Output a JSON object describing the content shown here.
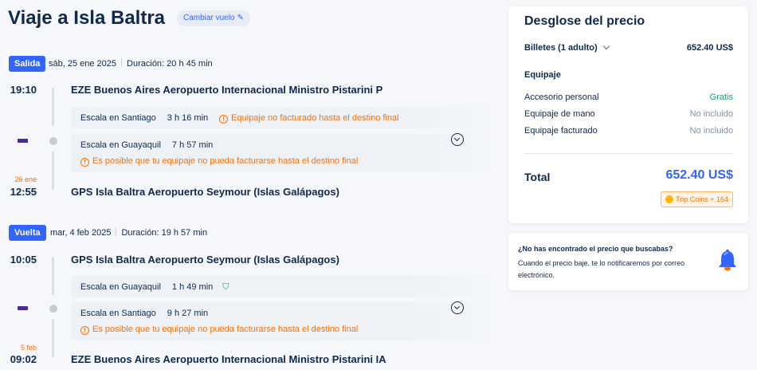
{
  "trip": {
    "title": "Viaje a Isla Baltra",
    "change_label": "Cambiar vuelo",
    "change_icon": "pencil-icon"
  },
  "outbound": {
    "badge": "Salida",
    "date": "sáb, 25 ene 2025",
    "duration": "Duración: 20 h 45 min",
    "dep_time": "19:10",
    "dep_airport": "EZE Buenos Aires Aeropuerto Internacional Ministro Pistarini P",
    "stops": [
      {
        "label": "Escala en Santiago",
        "duration": "3 h 16 min",
        "note": "Equipaje no facturado hasta el destino final"
      },
      {
        "label": "Escala en Guayaquil",
        "duration": "7 h 57 min",
        "note": "Es posible que tu equipaje no pueda facturarse hasta el destino final"
      }
    ],
    "arr_day": "26 ene",
    "arr_time": "12:55",
    "arr_airport": "GPS Isla Baltra Aeropuerto Seymour (Islas Galápagos)"
  },
  "return": {
    "badge": "Vuelta",
    "date": "mar, 4 feb 2025",
    "duration": "Duración: 19 h 57 min",
    "dep_time": "10:05",
    "dep_airport": "GPS Isla Baltra Aeropuerto Seymour (Islas Galápagos)",
    "stops": [
      {
        "label": "Escala en Guayaquil",
        "duration": "1 h 49 min",
        "icon": "shield-icon"
      },
      {
        "label": "Escala en Santiago",
        "duration": "9 h 27 min",
        "note": "Es posible que tu equipaje no pueda facturarse hasta el destino final"
      }
    ],
    "arr_day": "5 feb",
    "arr_time": "09:02",
    "arr_airport": "EZE Buenos Aires Aeropuerto Internacional Ministro Pistarini IA"
  },
  "price": {
    "title": "Desglose del precio",
    "tickets_label": "Billetes (1 adulto)",
    "tickets_value": "652.40 US$",
    "baggage_heading": "Equipaje",
    "items": [
      {
        "label": "Accesorio personal",
        "value": "Gratis"
      },
      {
        "label": "Equipaje de mano",
        "value": "No incluido"
      },
      {
        "label": "Equipaje facturado",
        "value": "No incluido"
      }
    ],
    "total_label": "Total",
    "total_value": "652.40 US$",
    "coins": "Trip Coins + 164"
  },
  "alert": {
    "title": "¿No has encontrado el precio que buscabas?",
    "text": "Cuando el precio baje, te lo notificaremos por correo electrónico."
  },
  "colors": {
    "accent": "#3264ff",
    "warning": "#ff6f00",
    "success": "#12a67a",
    "text": "#0f294d"
  }
}
